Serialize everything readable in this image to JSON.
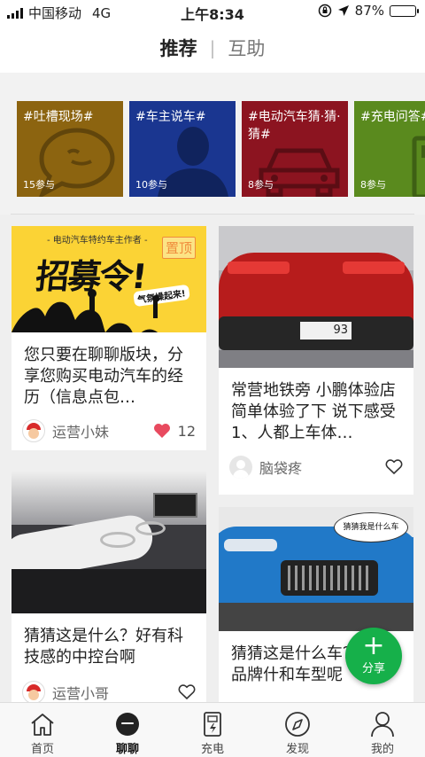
{
  "status": {
    "carrier": "中国移动",
    "network": "4G",
    "time": "上午8:34",
    "battery": "87%",
    "battery_level": 0.87
  },
  "topnav": {
    "tabs": [
      {
        "label": "推荐",
        "active": true
      },
      {
        "label": "互助",
        "active": false
      }
    ],
    "separator": "|"
  },
  "topics": [
    {
      "title": "#吐槽现场#",
      "count": "15参与",
      "color": "#8c6410",
      "icon": "chat-bubble-icon"
    },
    {
      "title": "#车主说车#",
      "count": "10参与",
      "color": "#1a3690",
      "icon": "person-silhouette-icon"
    },
    {
      "title": "#电动汽车猜·猜·猜#",
      "count": "8参与",
      "color": "#8c1420",
      "icon": "car-icon"
    },
    {
      "title": "#充电问答#",
      "count": "8参与",
      "color": "#5a8a1e",
      "icon": "charger-icon"
    }
  ],
  "posts": [
    {
      "image_label": "招募令!",
      "image_caption": "- 电动汽车特约车主作者 -",
      "image_sub": "气氛燥起来!",
      "badge": "置顶",
      "text": "您只要在聊聊版块，分享您购买电动汽车的经历（信息点包…",
      "author": "运营小妹",
      "likes": "12",
      "liked": true
    },
    {
      "image_plate": "93",
      "text": "常营地铁旁 小鹏体验店 简单体验了下 说下感受 1、人都上车体…",
      "author": "脑袋疼",
      "likes": ""
    },
    {
      "text": "猜猜这是什么？好有科技感的中控台啊",
      "author": "运营小哥",
      "likes": ""
    },
    {
      "image_bubble": "猜猜我是什么车",
      "text": "猜猜这是什么车？什么品牌什和车型呢",
      "author": "",
      "likes": ""
    }
  ],
  "fab": {
    "label": "分享",
    "icon": "plus-icon"
  },
  "bottomnav": [
    {
      "label": "首页",
      "icon": "home-icon",
      "active": false
    },
    {
      "label": "聊聊",
      "icon": "chat-icon",
      "active": true
    },
    {
      "label": "充电",
      "icon": "charging-station-icon",
      "active": false
    },
    {
      "label": "发现",
      "icon": "compass-icon",
      "active": false
    },
    {
      "label": "我的",
      "icon": "user-icon",
      "active": false
    }
  ],
  "colors": {
    "accent": "#16b04a",
    "like": "#e84a5f",
    "badge": "#f08c3c"
  }
}
